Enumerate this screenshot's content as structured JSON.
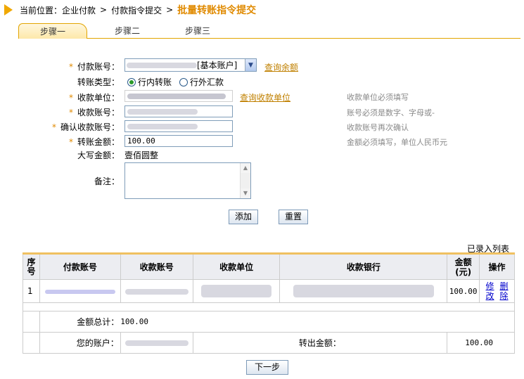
{
  "breadcrumb": {
    "prefix": "当前位置：",
    "items": [
      "企业付款",
      "付款指令提交"
    ],
    "current": "批量转账指令提交",
    "separator": ">"
  },
  "tabs": [
    "步骤一",
    "步骤二",
    "步骤三"
  ],
  "form": {
    "payer_label": "付款账号：",
    "payer_select_suffix": "[基本账户]",
    "query_balance": "查询余额",
    "transfer_type_label": "转账类型：",
    "transfer_options": [
      "行内转账",
      "行外汇款"
    ],
    "payee_unit_label": "收款单位：",
    "query_payee_unit": "查询收款单位",
    "payee_account_label": "收款账号：",
    "confirm_account_label": "确认收款账号：",
    "amount_label": "转账金额：",
    "amount_value": "100.00",
    "amount_words_label": "大写金额：",
    "amount_words_value": "壹佰圆整",
    "remark_label": "备注：",
    "hints": [
      "收款单位必须填写",
      "账号必须是数字、字母或-",
      "收款账号再次确认",
      "金额必须填写，单位人民币元"
    ],
    "required_mark": "*"
  },
  "buttons": {
    "add": "添加",
    "reset": "重置",
    "next": "下一步"
  },
  "list": {
    "title": "已录入列表",
    "headers": [
      "序号",
      "付款账号",
      "收款账号",
      "收款单位",
      "收款银行",
      "金额(元)",
      "操作"
    ],
    "row": {
      "index": "1",
      "amount": "100.00",
      "edit": "修改",
      "delete": "删除"
    },
    "total_label": "金额总计：",
    "total_value": "100.00",
    "your_account_label": "您的账户：",
    "out_amount_label": "转出金额：",
    "out_amount_value": "100.00"
  },
  "colors": {
    "accent": "#e08a00",
    "tab_border": "#e2a400",
    "header_bg": "#ecedf1"
  }
}
